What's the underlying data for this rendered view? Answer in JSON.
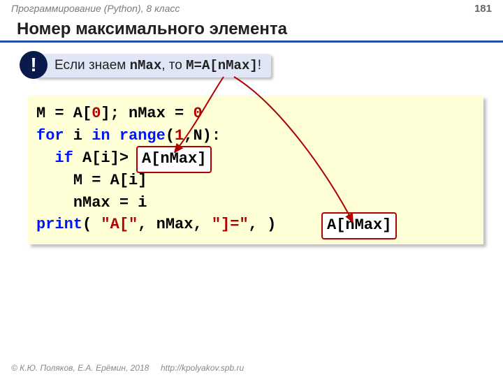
{
  "topbar": {
    "course": "Программирование (Python), 8 класс",
    "page": "181"
  },
  "title": "Номер максимального элемента",
  "callout": {
    "badge": "!",
    "pre": "Если знаем ",
    "mono1": "nMax",
    "mid": ", то ",
    "mono2": "M=A[nMax]",
    "post": "!"
  },
  "code": {
    "l1a": "M = A[",
    "l1zero": "0",
    "l1b": "]; nMax = ",
    "l1zero2": "0",
    "l2for": "for",
    "l2sp1": " i ",
    "l2in": "in",
    "l2sp2": " ",
    "l2range": "range",
    "l2args": "(",
    "l2one": "1",
    "l2args2": ",N):",
    "l3if": "if",
    "l3a": " A[i]>         :",
    "l4": "M = A[i]",
    "l5": "nMax = i",
    "l6print": "print",
    "l6a": "( ",
    "l6s1": "\"A[\"",
    "l6b": ", nMax, ",
    "l6s2": "\"]=\"",
    "l6c": ",          )"
  },
  "hl1": "A[nMax]",
  "hl2": "A[nMax]",
  "footer": {
    "copy": "© К.Ю. Поляков, Е.А. Ерёмин, 2018",
    "url": "http://kpolyakov.spb.ru"
  }
}
